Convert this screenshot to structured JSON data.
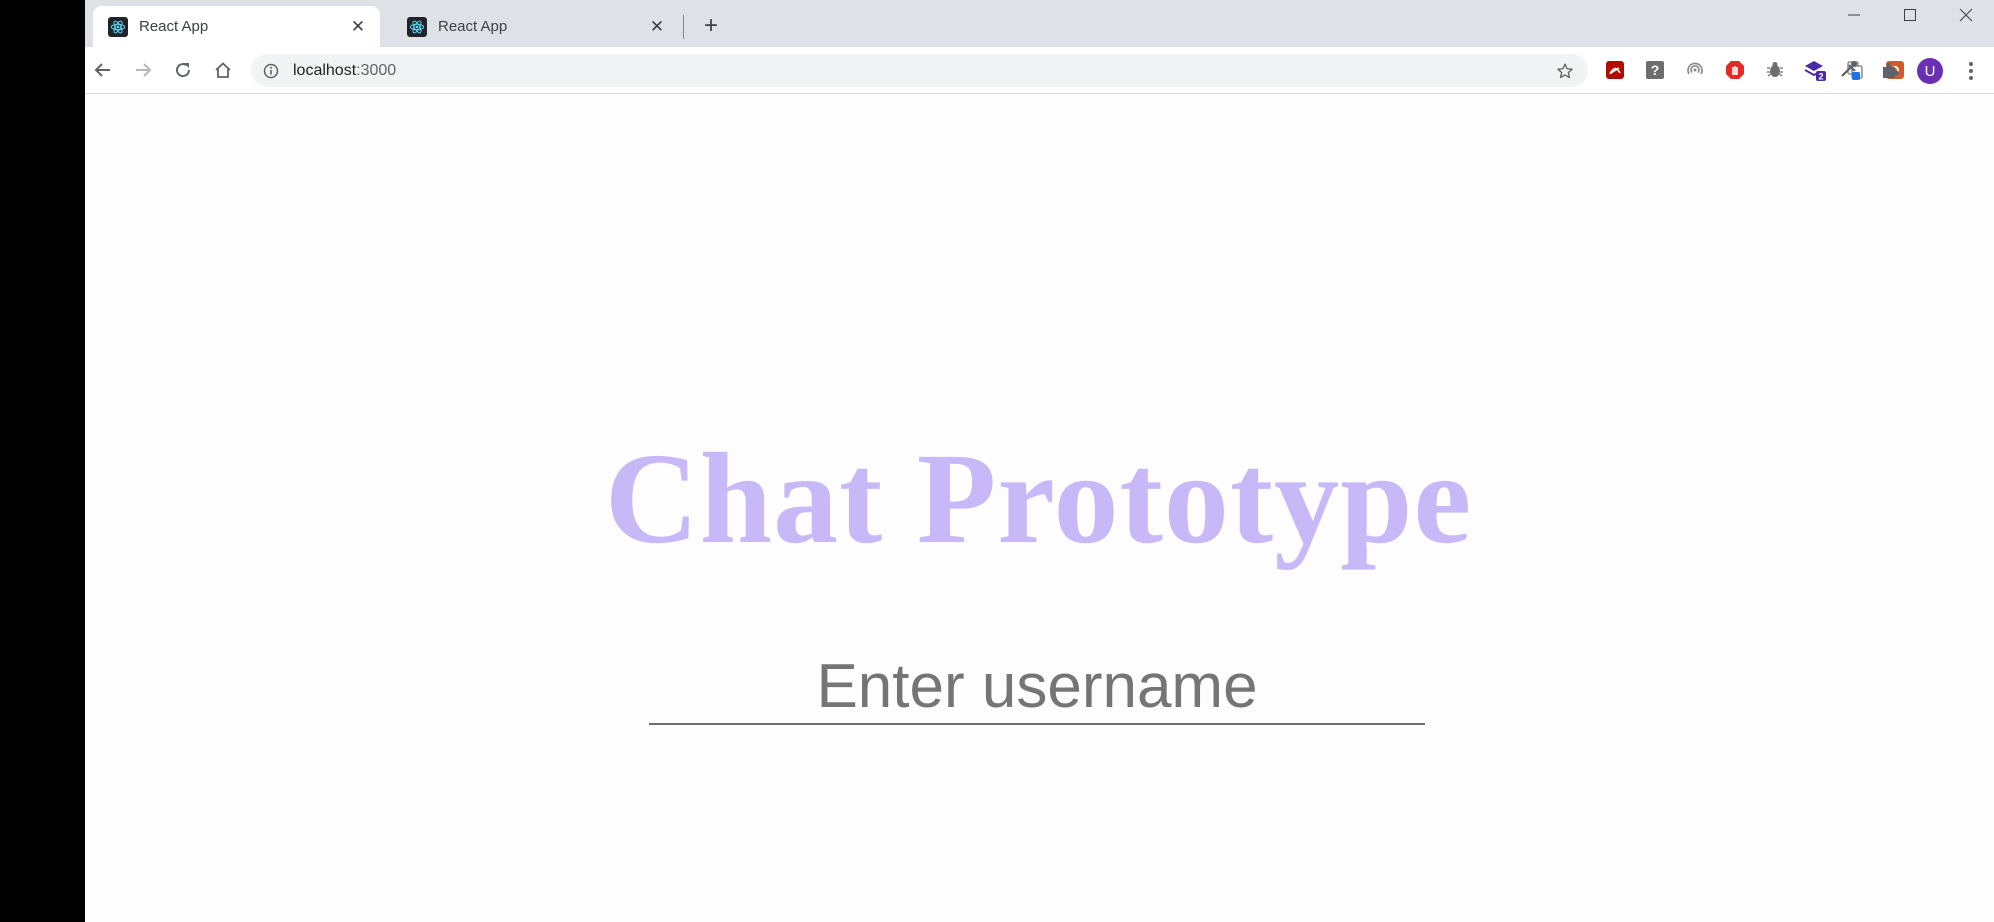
{
  "tabs": [
    {
      "title": "React App",
      "close": "✕"
    },
    {
      "title": "React App",
      "close": "✕"
    }
  ],
  "new_tab_label": "+",
  "window_controls": {
    "minimize": "—",
    "maximize": "☐",
    "close": "✕"
  },
  "address_bar": {
    "host": "localhost",
    "port": ":3000"
  },
  "extensions": [
    {
      "icon": "pdf-icon",
      "color": "#b30b00"
    },
    {
      "icon": "help-icon",
      "color": "#6e6e6e"
    },
    {
      "icon": "antenna-icon",
      "color": "#6e6e6e"
    },
    {
      "icon": "adblock-stop-icon",
      "color": "#e22b26"
    },
    {
      "icon": "bug-icon",
      "color": "#6e6e6e"
    },
    {
      "icon": "layers-icon",
      "color": "#4a2aa8",
      "badge": "2"
    },
    {
      "icon": "copy-icon",
      "color": "#8a8a8a"
    },
    {
      "icon": "screenshot-icon",
      "color": "#d35a2a"
    },
    {
      "icon": "eyedropper-icon",
      "color": "#5f6368"
    },
    {
      "icon": "puzzle-icon",
      "color": "#5f6368"
    }
  ],
  "profile": {
    "initial": "U",
    "color": "#6b2fb3"
  },
  "page": {
    "heading": "Chat Prototype",
    "username_placeholder": "Enter username",
    "heading_color": "#c8b8f8"
  }
}
